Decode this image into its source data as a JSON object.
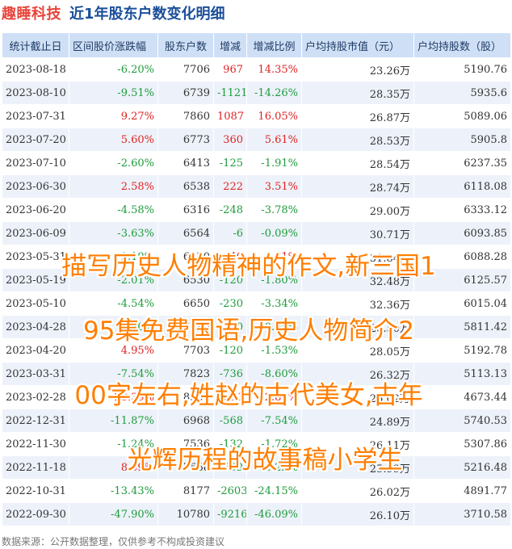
{
  "header": {
    "brand": "趣睡科技",
    "title": "近1年股东户数变化明细"
  },
  "columns": [
    "统计截止日",
    "区间股价涨跌幅",
    "股东户数",
    "增减",
    "增减比例",
    "户均持股市值（元）",
    "户均持股数（股）"
  ],
  "rows": [
    {
      "date": "2023-08-18",
      "change": "-6.20%",
      "holders": "7706",
      "delta": "967",
      "ratio": "14.35%",
      "value": "23.26万",
      "shares": "5190.76"
    },
    {
      "date": "2023-08-10",
      "change": "-9.51%",
      "holders": "6739",
      "delta": "-1121",
      "ratio": "-14.26%",
      "value": "28.35万",
      "shares": "5935.6"
    },
    {
      "date": "2023-07-31",
      "change": "9.27%",
      "holders": "7860",
      "delta": "1087",
      "ratio": "16.05%",
      "value": "26.87万",
      "shares": "5089.06"
    },
    {
      "date": "2023-07-20",
      "change": "5.60%",
      "holders": "6773",
      "delta": "360",
      "ratio": "5.61%",
      "value": "28.53万",
      "shares": "5905.8"
    },
    {
      "date": "2023-07-10",
      "change": "-2.60%",
      "holders": "6413",
      "delta": "-125",
      "ratio": "-1.91%",
      "value": "28.54万",
      "shares": "6237.35"
    },
    {
      "date": "2023-06-30",
      "change": "2.58%",
      "holders": "6538",
      "delta": "222",
      "ratio": "3.51%",
      "value": "28.74万",
      "shares": "6118.08"
    },
    {
      "date": "2023-06-20",
      "change": "-4.58%",
      "holders": "6316",
      "delta": "-248",
      "ratio": "-3.78%",
      "value": "29.00万",
      "shares": "6333.12"
    },
    {
      "date": "2023-06-09",
      "change": "-3.63%",
      "holders": "6564",
      "delta": "-6",
      "ratio": "-0.09%",
      "value": "30.71万",
      "shares": "6093.85"
    },
    {
      "date": "2023-05-31",
      "change": "-2.19%",
      "holders": "6570",
      "delta": "40",
      "ratio": "0.61%",
      "value": "31.84万",
      "shares": "6088.28"
    },
    {
      "date": "2023-05-19",
      "change": "-2.01%",
      "holders": "6530",
      "delta": "-120",
      "ratio": "-1.80%",
      "value": "32.48万",
      "shares": "6125.57"
    },
    {
      "date": "2023-05-10",
      "change": "-4.54%",
      "holders": "6650",
      "delta": "-230",
      "ratio": "-3.34%",
      "value": "32.36万",
      "shares": "6015.04"
    },
    {
      "date": "2023-04-28",
      "change": "-1.20%",
      "holders": "6880",
      "delta": "-820",
      "ratio": "-10.65%",
      "value": "28.50万",
      "shares": "5811.42"
    },
    {
      "date": "2023-04-20",
      "change": "4.95%",
      "holders": "7703",
      "delta": "-120",
      "ratio": "-1.53%",
      "value": "28.05万",
      "shares": "5192.78"
    },
    {
      "date": "2023-03-31",
      "change": "-7.54%",
      "holders": "7823",
      "delta": "-736",
      "ratio": "-8.60%",
      "value": "26.32万",
      "shares": "5113.13"
    },
    {
      "date": "2023-02-28",
      "change": "28.39%",
      "holders": "8559",
      "delta": "1591",
      "ratio": "22.83%",
      "value": "26.02万",
      "shares": "4673.44"
    },
    {
      "date": "2022-12-31",
      "change": "-11.87%",
      "holders": "6968",
      "delta": "-568",
      "ratio": "-7.54%",
      "value": "24.89万",
      "shares": "5740.53"
    },
    {
      "date": "2022-11-30",
      "change": "-1.24%",
      "holders": "7536",
      "delta": "-132",
      "ratio": "-1.72%",
      "value": "26.11万",
      "shares": "5307.86"
    },
    {
      "date": "2022-11-18",
      "change": "8.59%",
      "holders": "7668",
      "delta": "-509",
      "ratio": "-6.22%",
      "value": "25.99万",
      "shares": "5216.48"
    },
    {
      "date": "2022-10-31",
      "change": "-13.43%",
      "holders": "8177",
      "delta": "-2603",
      "ratio": "-24.15%",
      "value": "26.02万",
      "shares": "4891.77"
    },
    {
      "date": "2022-09-30",
      "change": "-47.90%",
      "holders": "10780",
      "delta": "-9216",
      "ratio": "-46.09%",
      "value": "26.10万",
      "shares": "3710.58"
    }
  ],
  "overlay": {
    "lines": [
      "描写历史人物精神的作文,新三国1",
      "95集免费国语,历史人物简介2",
      "00字左右,姓赵的古代美女,古年",
      "光辉历程的故事稿小学生"
    ]
  },
  "footer": {
    "source": "数据来源：公开数据整理，仅供参考不构成投资建议"
  },
  "colors": {
    "positive": "#e02222",
    "negative": "#1e9b3c",
    "header_bg": "#cfe0f6",
    "brand": "#e8443a",
    "title": "#1b4f9a",
    "overlay": "#ff7e00"
  }
}
